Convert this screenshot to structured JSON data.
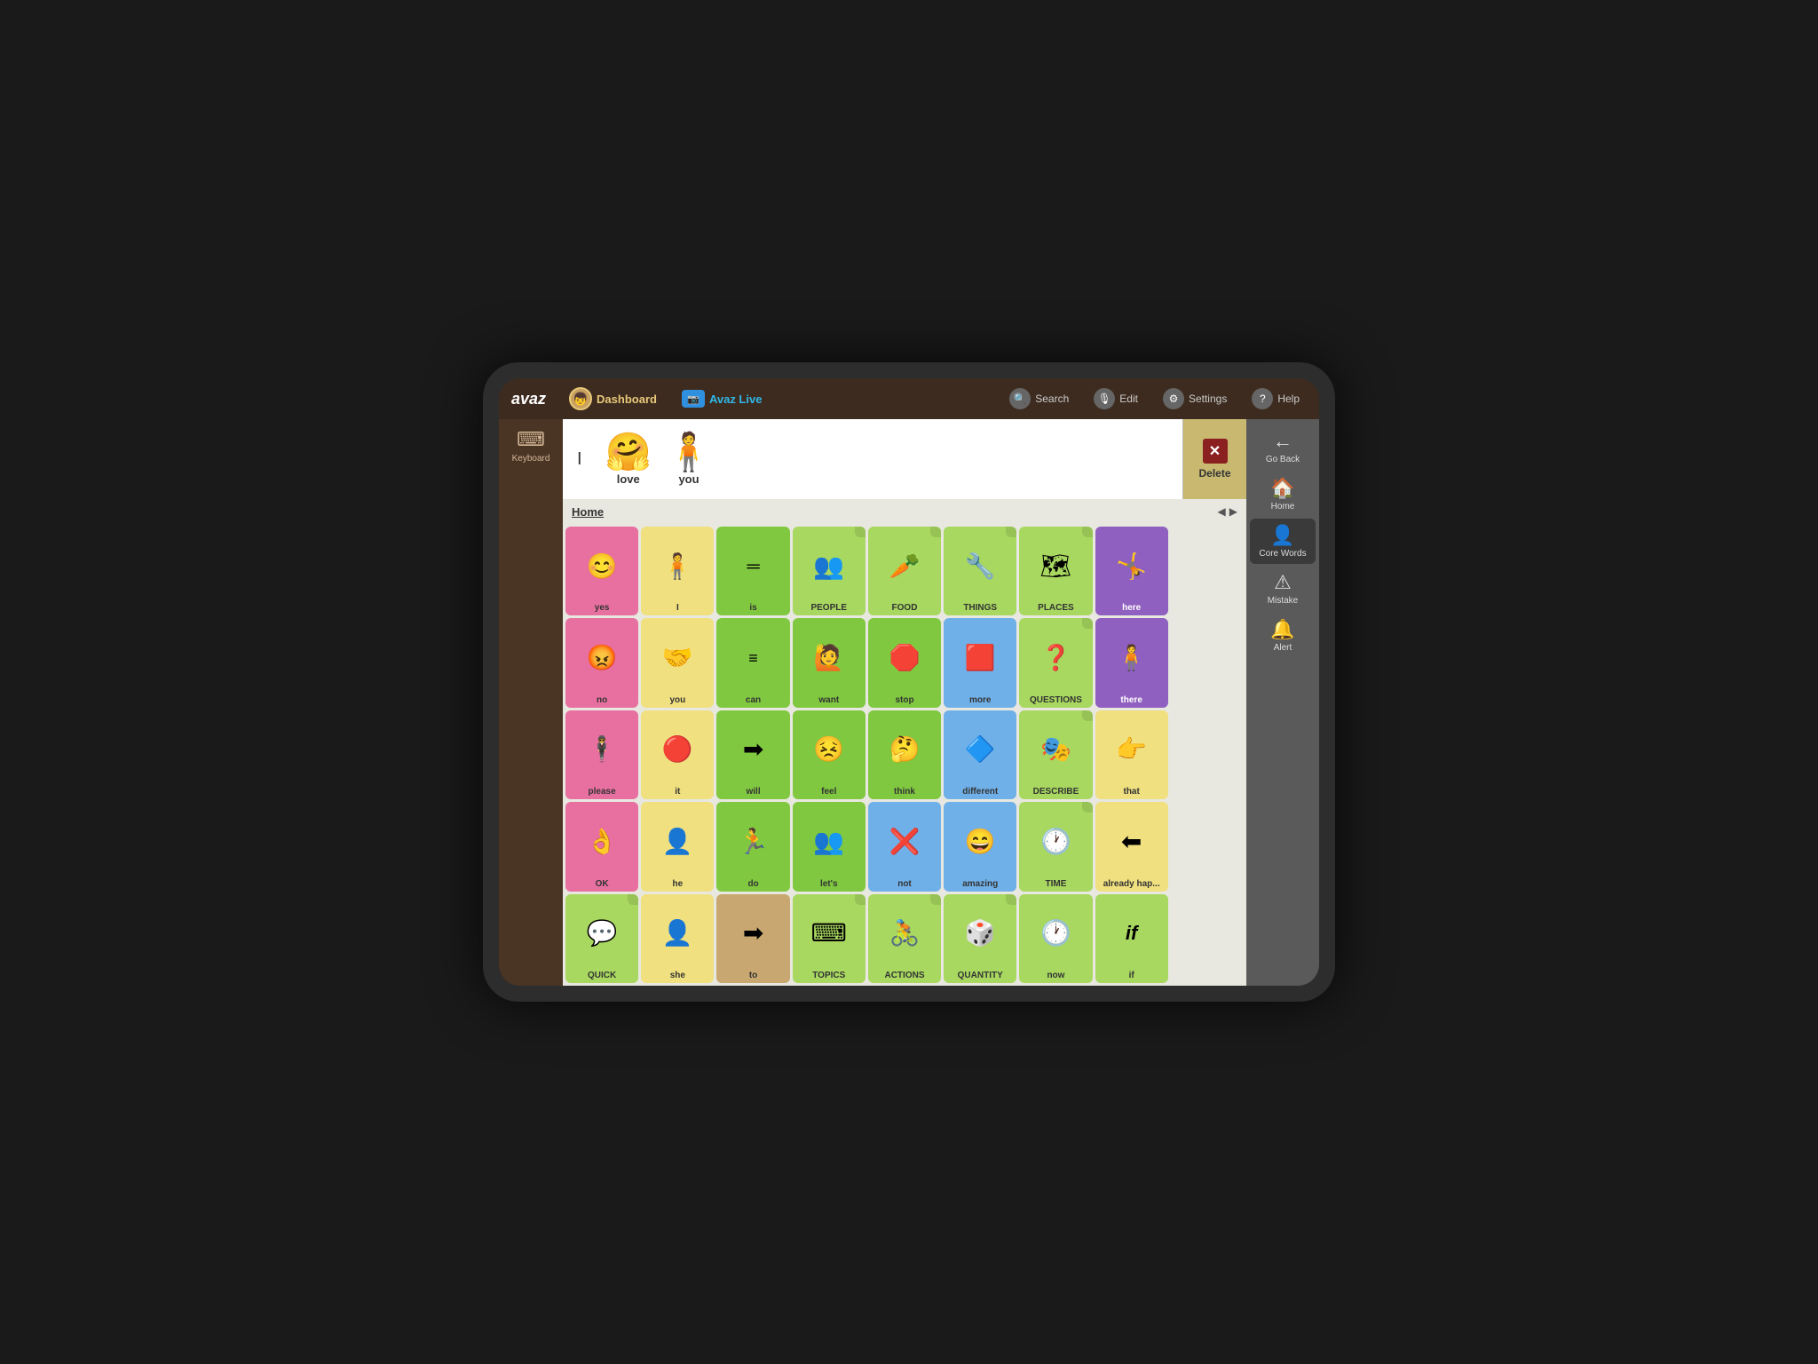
{
  "app": {
    "logo": "avaz",
    "nav": {
      "dashboard_label": "Dashboard",
      "avaz_live_label": "Avaz Live"
    },
    "top_actions": [
      "Search",
      "Edit",
      "Settings",
      "Help"
    ]
  },
  "keyboard": {
    "label": "Keyboard"
  },
  "sentence_bar": {
    "cursor": "I",
    "words": [
      {
        "label": "love",
        "emoji": "🤗"
      },
      {
        "label": "you",
        "emoji": "🧍"
      }
    ]
  },
  "delete_button": {
    "label": "Delete",
    "symbol": "✕"
  },
  "grid": {
    "title": "Home",
    "cells": [
      {
        "label": "yes",
        "color": "pink",
        "emoji": "😊"
      },
      {
        "label": "I",
        "color": "yellow",
        "emoji": "🧍"
      },
      {
        "label": "is",
        "color": "green",
        "emoji": "═"
      },
      {
        "label": "PEOPLE",
        "color": "light-green",
        "emoji": "👥",
        "folder": true
      },
      {
        "label": "FOOD",
        "color": "light-green",
        "emoji": "🥕",
        "folder": true
      },
      {
        "label": "THINGS",
        "color": "light-green",
        "emoji": "🔧",
        "folder": true
      },
      {
        "label": "PLACES",
        "color": "light-green",
        "emoji": "🗺",
        "folder": true
      },
      {
        "label": "here",
        "color": "purple",
        "emoji": "🤸"
      },
      {
        "label": "",
        "color": "",
        "emoji": ""
      },
      {
        "label": "no",
        "color": "pink",
        "emoji": "😠"
      },
      {
        "label": "you",
        "color": "yellow",
        "emoji": "🤝"
      },
      {
        "label": "can",
        "color": "green",
        "emoji": "═"
      },
      {
        "label": "want",
        "color": "green",
        "emoji": "🙋"
      },
      {
        "label": "stop",
        "color": "green",
        "emoji": "🛑"
      },
      {
        "label": "more",
        "color": "blue",
        "emoji": "🟥"
      },
      {
        "label": "QUESTIONS",
        "color": "light-green",
        "emoji": "❓",
        "folder": true
      },
      {
        "label": "there",
        "color": "purple",
        "emoji": "🧍"
      },
      {
        "label": "",
        "color": "",
        "emoji": ""
      },
      {
        "label": "please",
        "color": "pink",
        "emoji": "🕴"
      },
      {
        "label": "it",
        "color": "yellow",
        "emoji": "🔴"
      },
      {
        "label": "will",
        "color": "green",
        "emoji": "➡"
      },
      {
        "label": "feel",
        "color": "green",
        "emoji": "😣"
      },
      {
        "label": "think",
        "color": "green",
        "emoji": "🤔"
      },
      {
        "label": "different",
        "color": "blue",
        "emoji": "🔷"
      },
      {
        "label": "DESCRIBE",
        "color": "light-green",
        "emoji": "🎭",
        "folder": true
      },
      {
        "label": "that",
        "color": "yellow",
        "emoji": "👉"
      },
      {
        "label": "",
        "color": "",
        "emoji": ""
      },
      {
        "label": "OK",
        "color": "pink",
        "emoji": "👌"
      },
      {
        "label": "he",
        "color": "yellow",
        "emoji": "👤"
      },
      {
        "label": "do",
        "color": "green",
        "emoji": "🏃"
      },
      {
        "label": "let's",
        "color": "green",
        "emoji": "👥"
      },
      {
        "label": "not",
        "color": "blue",
        "emoji": "❌"
      },
      {
        "label": "amazing",
        "color": "blue",
        "emoji": "😄"
      },
      {
        "label": "TIME",
        "color": "light-green",
        "emoji": "🕐",
        "folder": true
      },
      {
        "label": "already hap...",
        "color": "yellow",
        "emoji": "⬅"
      },
      {
        "label": "",
        "color": "",
        "emoji": ""
      },
      {
        "label": "QUICK",
        "color": "light-green",
        "emoji": "💬",
        "folder": true
      },
      {
        "label": "she",
        "color": "yellow",
        "emoji": "👤"
      },
      {
        "label": "to",
        "color": "tan",
        "emoji": "➡"
      },
      {
        "label": "TOPICS",
        "color": "light-green",
        "emoji": "⌨",
        "folder": true
      },
      {
        "label": "ACTIONS",
        "color": "light-green",
        "emoji": "🚴",
        "folder": true
      },
      {
        "label": "QUANTITY",
        "color": "light-green",
        "emoji": "🎲",
        "folder": true
      },
      {
        "label": "now",
        "color": "light-green",
        "emoji": "🕐"
      },
      {
        "label": "if",
        "color": "light-green",
        "emoji": "if"
      },
      {
        "label": "",
        "color": "",
        "emoji": ""
      }
    ]
  },
  "right_panel": {
    "go_back": "Go Back",
    "home": "Home",
    "core_words": "Core Words",
    "mistake": "Mistake",
    "alert": "Alert"
  }
}
